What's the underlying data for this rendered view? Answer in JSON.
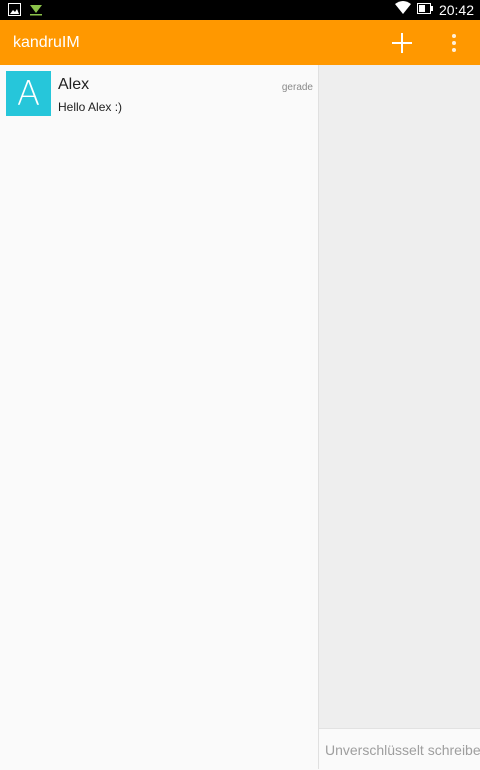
{
  "status_bar": {
    "time": "20:42",
    "icons": [
      "image-icon",
      "download-icon",
      "wifi-icon",
      "battery-icon"
    ]
  },
  "app_bar": {
    "title": "kandruIM",
    "background": "#ff9800",
    "actions": [
      "add-icon",
      "overflow-menu-icon"
    ]
  },
  "conversations": [
    {
      "avatar_letter": "A",
      "avatar_color": "#26c6da",
      "name": "Alex",
      "preview": "Hello Alex :)",
      "time": "gerade"
    }
  ],
  "compose": {
    "placeholder": "Unverschlüsselt schreiben…"
  }
}
